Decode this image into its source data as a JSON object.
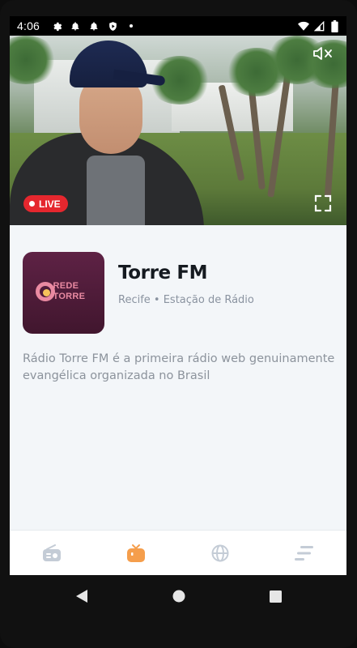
{
  "status_bar": {
    "time": "4:06",
    "left_icons": [
      "settings-icon",
      "notification-bell-icon",
      "notification-bell-icon",
      "play-shield-icon",
      "dot-icon"
    ],
    "right_icons": [
      "wifi-icon",
      "cellular-signal-icon",
      "battery-icon"
    ]
  },
  "video": {
    "live_label": "LIVE",
    "live_color": "#e5272e",
    "mute_icon": "volume-muted-icon",
    "fullscreen_icon": "fullscreen-icon"
  },
  "station": {
    "logo_text_line1": "REDE",
    "logo_text_line2": "TORRE",
    "name": "Torre FM",
    "meta": "Recife • Estação de Rádio",
    "description": "Rádio Torre FM é a primeira rádio web genuinamente evangélica organizada no Brasil"
  },
  "bottom_nav": {
    "items": [
      {
        "icon": "radio-icon",
        "active": false
      },
      {
        "icon": "tv-icon",
        "active": true
      },
      {
        "icon": "globe-icon",
        "active": false
      },
      {
        "icon": "menu-icon",
        "active": false
      }
    ],
    "active_color": "#f59e4c",
    "inactive_color": "#c4ccd6"
  },
  "system_nav": {
    "buttons": [
      "back-icon",
      "home-icon",
      "recents-icon"
    ]
  }
}
